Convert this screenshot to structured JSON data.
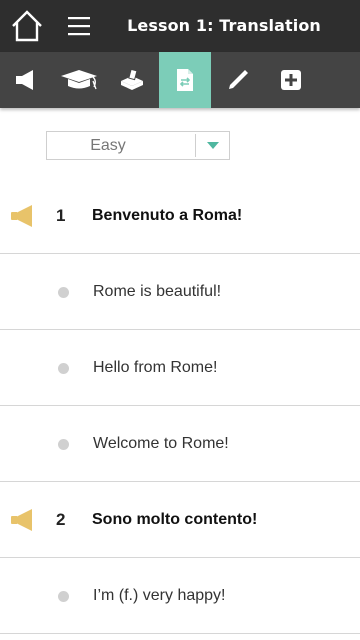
{
  "header": {
    "title": "Lesson 1: Translation",
    "home_icon": "home-icon",
    "menu_icon": "hamburger-menu-icon"
  },
  "toolbar": {
    "active_index": 3,
    "active_color": "#7ccdb8",
    "items": [
      {
        "icon": "megaphone-icon"
      },
      {
        "icon": "graduation-cap-icon"
      },
      {
        "icon": "vote-box-icon"
      },
      {
        "icon": "translation-document-icon"
      },
      {
        "icon": "pencil-icon"
      },
      {
        "icon": "plus-square-icon"
      }
    ]
  },
  "difficulty": {
    "selected": "Easy",
    "arrow_color": "#4fb7a0"
  },
  "phrases": [
    {
      "number": "1",
      "text": "Benvenuto a Roma!",
      "options": [
        "Rome is beautiful!",
        "Hello from Rome!",
        "Welcome to Rome!"
      ]
    },
    {
      "number": "2",
      "text": "Sono molto contento!",
      "options": [
        "I’m (f.) very happy!"
      ]
    }
  ],
  "colors": {
    "header_bg": "#2e2e2e",
    "toolbar_bg": "#444444",
    "speaker": "#e8c36a"
  }
}
